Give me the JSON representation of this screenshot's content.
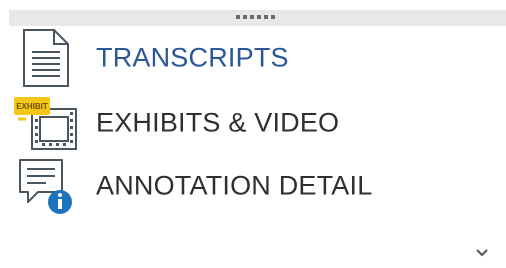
{
  "nav": {
    "items": [
      {
        "label": "TRANSCRIPTS",
        "icon": "document-icon",
        "active": true
      },
      {
        "label": "EXHIBITS & VIDEO",
        "icon": "exhibit-video-icon",
        "badge": "EXHIBIT",
        "active": false
      },
      {
        "label": "ANNOTATION DETAIL",
        "icon": "annotation-info-icon",
        "active": false
      }
    ]
  },
  "footer": {
    "expand_icon": "chevron-down-icon"
  },
  "colors": {
    "active_label": "#2b5797",
    "label": "#2f2f2f",
    "grip_bar": "#e8e8e8",
    "badge_yellow": "#f5c518",
    "info_blue": "#1e73be"
  }
}
